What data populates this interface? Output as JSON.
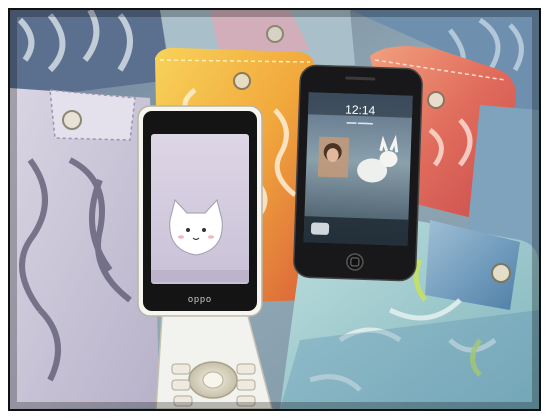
{
  "photo": {
    "description_free": true,
    "phone_white": {
      "brand": "oppo",
      "cat_icon": "cat-face-icon"
    },
    "phone_black": {
      "lock_time": "12:14"
    },
    "colors": {
      "pouch_yellow": "#f2b443",
      "pouch_red": "#d65a4a",
      "pouch_lilac": "#cfc9da",
      "pouch_teal": "#9cc4c8",
      "pouch_blue": "#6f9cc0",
      "black_phone": "#1a1a1c",
      "white_phone": "#f2f2ee"
    }
  }
}
